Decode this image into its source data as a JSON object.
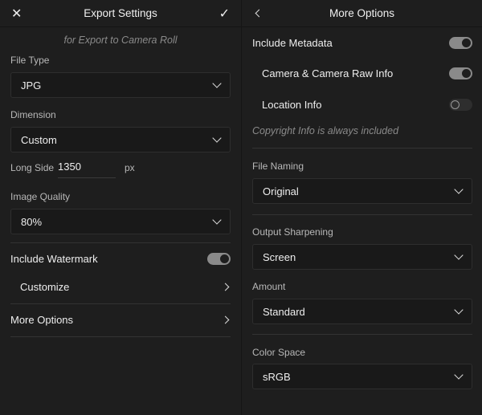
{
  "left": {
    "title": "Export Settings",
    "subtitle": "for Export to Camera Roll",
    "file_type": {
      "label": "File Type",
      "value": "JPG"
    },
    "dimension": {
      "label": "Dimension",
      "value": "Custom"
    },
    "long_side": {
      "label": "Long Side",
      "value": "1350",
      "unit": "px"
    },
    "image_quality": {
      "label": "Image Quality",
      "value": "80%"
    },
    "include_watermark": {
      "label": "Include Watermark",
      "on": true
    },
    "customize": "Customize",
    "more_options": "More Options"
  },
  "right": {
    "title": "More Options",
    "include_metadata": {
      "label": "Include Metadata",
      "on": true
    },
    "camera_raw_info": {
      "label": "Camera & Camera Raw Info",
      "on": true
    },
    "location_info": {
      "label": "Location Info",
      "on": false
    },
    "copyright_note": "Copyright Info is always included",
    "file_naming": {
      "label": "File Naming",
      "value": "Original"
    },
    "output_sharpening": {
      "label": "Output Sharpening",
      "value": "Screen"
    },
    "amount": {
      "label": "Amount",
      "value": "Standard"
    },
    "color_space": {
      "label": "Color Space",
      "value": "sRGB"
    }
  }
}
